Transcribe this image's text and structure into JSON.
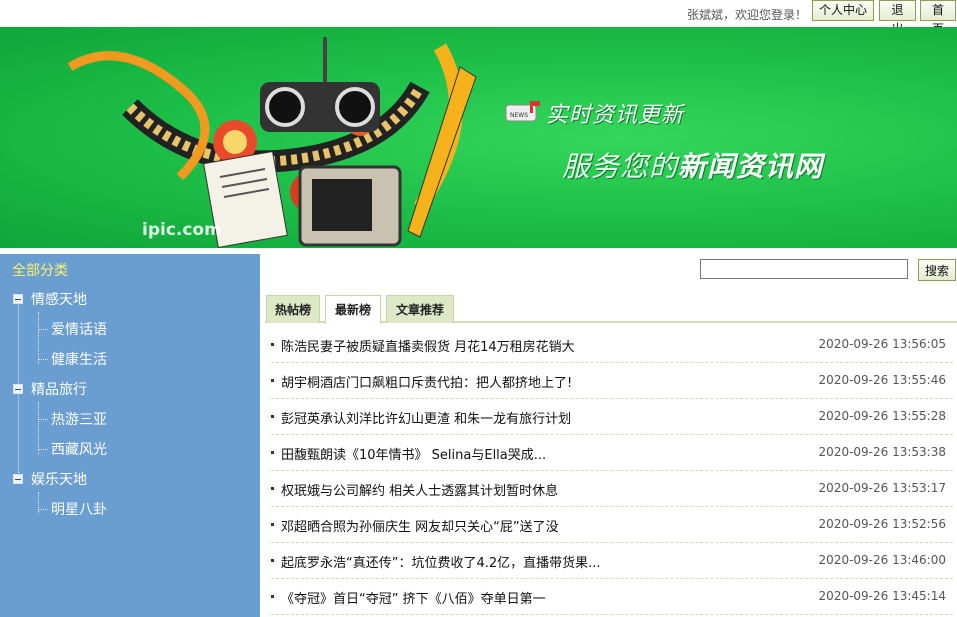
{
  "header": {
    "welcome": "张斌斌，欢迎您登录！",
    "personal_center": "个人中心",
    "logout": "退出",
    "home": "首页"
  },
  "banner": {
    "slogan_line1": "实时资讯更新",
    "slogan_line2_prefix": "服务您的",
    "slogan_line2_strong": "新闻资讯网",
    "watermark": "ipic.com",
    "badge_text": "NEWS",
    "colors": {
      "background": "#1fc24a",
      "accent": "#ffffff"
    }
  },
  "sidebar": {
    "all_label": "全部分类",
    "groups": [
      {
        "label": "情感天地",
        "children": [
          "爱情话语",
          "健康生活"
        ]
      },
      {
        "label": "精品旅行",
        "children": [
          "热游三亚",
          "西藏风光"
        ]
      },
      {
        "label": "娱乐天地",
        "children": [
          "明星八卦"
        ]
      }
    ],
    "colors": {
      "background": "#6a9ed1",
      "highlight": "#fff36a"
    }
  },
  "search": {
    "button_label": "搜索",
    "value": "",
    "placeholder": ""
  },
  "tabs": [
    {
      "label": "热帖榜",
      "active": false
    },
    {
      "label": "最新榜",
      "active": true
    },
    {
      "label": "文章推荐",
      "active": false
    }
  ],
  "news": [
    {
      "title": "陈浩民妻子被质疑直播卖假货 月花14万租房花销大",
      "time": "2020-09-26 13:56:05"
    },
    {
      "title": "胡宇桐酒店门口飙粗口斥责代拍：把人都挤地上了!",
      "time": "2020-09-26 13:55:46"
    },
    {
      "title": "彭冠英承认刘洋比许幻山更渣 和朱一龙有旅行计划",
      "time": "2020-09-26 13:55:28"
    },
    {
      "title": "田馥甄朗读《10年情书》 Selina与Ella哭成...",
      "time": "2020-09-26 13:53:38"
    },
    {
      "title": "权珉娥与公司解约 相关人士透露其计划暂时休息",
      "time": "2020-09-26 13:53:17"
    },
    {
      "title": "邓超晒合照为孙俪庆生 网友却只关心“屁”送了没",
      "time": "2020-09-26 13:52:56"
    },
    {
      "title": "起底罗永浩“真还传”：坑位费收了4.2亿，直播带货果...",
      "time": "2020-09-26 13:46:00"
    },
    {
      "title": "《夺冠》首日“夺冠” 挤下《八佰》夺单日第一",
      "time": "2020-09-26 13:45:14"
    }
  ]
}
